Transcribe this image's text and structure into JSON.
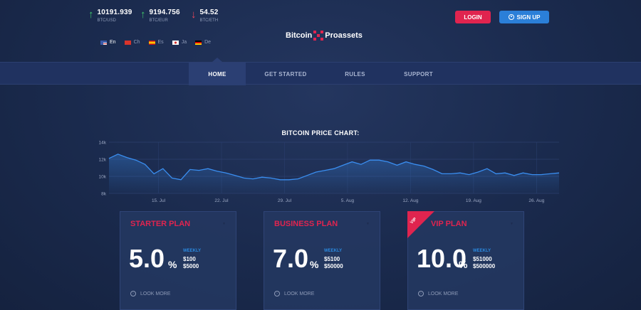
{
  "tickers": [
    {
      "value": "10191.939",
      "pair": "BTC/USD",
      "direction": "up",
      "arrow": "↑"
    },
    {
      "value": "9194.756",
      "pair": "BTC/EUR",
      "direction": "up",
      "arrow": "↑"
    },
    {
      "value": "54.52",
      "pair": "BTC/ETH",
      "direction": "down",
      "arrow": "↓"
    }
  ],
  "languages": [
    {
      "label": "En",
      "active": true
    },
    {
      "label": "Ch",
      "active": false
    },
    {
      "label": "Es",
      "active": false
    },
    {
      "label": "Ja",
      "active": false
    },
    {
      "label": "De",
      "active": false
    }
  ],
  "logo": {
    "left": "Bitcoin",
    "right": "Proassets"
  },
  "auth": {
    "login": "LOGIN",
    "signup": "SIGN UP"
  },
  "nav": [
    {
      "label": "HOME",
      "active": true
    },
    {
      "label": "GET STARTED",
      "active": false
    },
    {
      "label": "RULES",
      "active": false
    },
    {
      "label": "SUPPORT",
      "active": false
    }
  ],
  "colors": {
    "accent_red": "#e0244f",
    "accent_blue": "#2b7fd8",
    "positive": "#3fc56a",
    "negative": "#e8465a",
    "chart_line": "#3a8ef0"
  },
  "chart_data": {
    "type": "area",
    "title": "BITCOIN PRICE CHART:",
    "y_ticks": [
      "14k",
      "12k",
      "10k",
      "8k"
    ],
    "ylim": [
      8000,
      14000
    ],
    "x_ticks": [
      {
        "x": 5.5,
        "label": "15. Jul"
      },
      {
        "x": 12.5,
        "label": "22. Jul"
      },
      {
        "x": 19.5,
        "label": "29. Jul"
      },
      {
        "x": 26.5,
        "label": "5. Aug"
      },
      {
        "x": 33.5,
        "label": "12. Aug"
      },
      {
        "x": 40.5,
        "label": "19. Aug"
      },
      {
        "x": 47.5,
        "label": "26. Aug"
      }
    ],
    "xlim": [
      0,
      50
    ],
    "x": [
      0,
      1,
      2,
      3,
      4,
      5,
      6,
      7,
      8,
      9,
      10,
      11,
      12,
      13,
      14,
      15,
      16,
      17,
      18,
      19,
      20,
      21,
      22,
      23,
      24,
      25,
      26,
      27,
      28,
      29,
      30,
      31,
      32,
      33,
      34,
      35,
      36,
      37,
      38,
      39,
      40,
      41,
      42,
      43,
      44,
      45,
      46,
      47,
      48,
      49,
      50
    ],
    "values": [
      12100,
      12600,
      12200,
      11900,
      11400,
      10300,
      10900,
      9800,
      9600,
      10800,
      10700,
      10900,
      10600,
      10400,
      10100,
      9800,
      9700,
      9900,
      9800,
      9600,
      9600,
      9700,
      10100,
      10500,
      10700,
      10900,
      11300,
      11700,
      11400,
      11900,
      11900,
      11700,
      11300,
      11700,
      11400,
      11200,
      10800,
      10300,
      10300,
      10400,
      10200,
      10500,
      10900,
      10300,
      10400,
      10100,
      10400,
      10200,
      10200,
      10300,
      10400
    ],
    "grid": true
  },
  "plans": [
    {
      "name": "STARTER PLAN",
      "rate": "5.0",
      "unit": "%",
      "period": "WEEKLY",
      "min": "$100",
      "max": "$5000",
      "more": "LOOK MORE",
      "badge": ""
    },
    {
      "name": "BUSINESS PLAN",
      "rate": "7.0",
      "unit": "%",
      "period": "WEEKLY",
      "min": "$5100",
      "max": "$50000",
      "more": "LOOK MORE",
      "badge": ""
    },
    {
      "name": "VIP PLAN",
      "rate": "10.0",
      "unit": "%",
      "period": "WEEKLY",
      "min": "$51000",
      "max": "$500000",
      "more": "LOOK MORE",
      "badge": "VIP"
    }
  ]
}
